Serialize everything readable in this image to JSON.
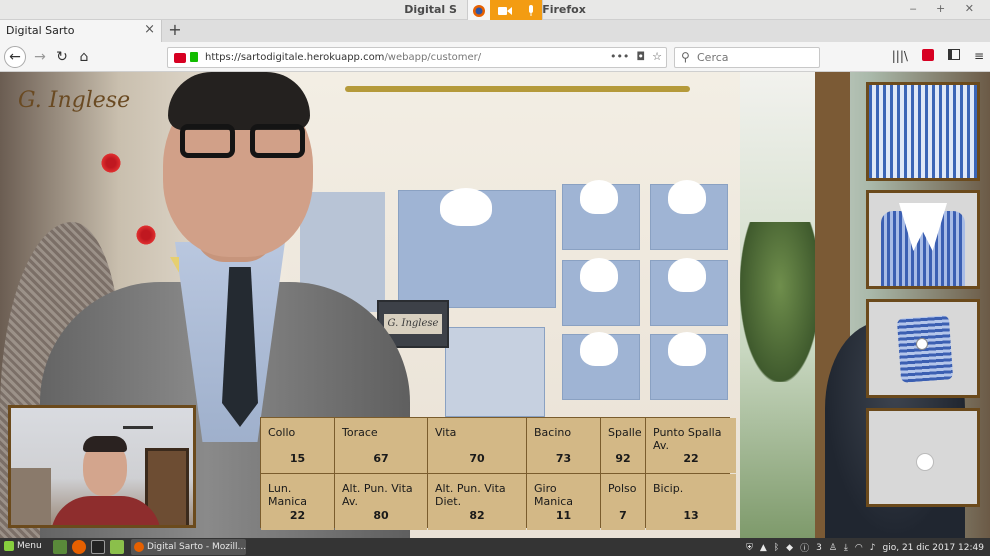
{
  "window": {
    "title": "Digital Sarto - Mozilla Firefox",
    "title_left": "Digital S",
    "title_right": "a Firefox",
    "controls": "‒ + ✕"
  },
  "tab": {
    "title": "Digital Sarto",
    "close": "×",
    "new_tab": "+"
  },
  "nav": {
    "back": "←",
    "forward": "→",
    "reload": "↻",
    "home": "⌂",
    "url_host": "https://sartodigitale.herokuapp.com",
    "url_path": "/webapp/customer/",
    "more": "•••",
    "pocket": "◘",
    "bookmark": "☆"
  },
  "search": {
    "placeholder": "Cerca",
    "icon": "search-icon"
  },
  "toolbar": {
    "library": "|||\\",
    "menu": "≡"
  },
  "page": {
    "logo": "G. Inglese",
    "sign_text": "G. Inglese"
  },
  "measurements": [
    {
      "label": "Collo",
      "value": "15"
    },
    {
      "label": "Torace",
      "value": "67"
    },
    {
      "label": "Vita",
      "value": "70"
    },
    {
      "label": "Bacino",
      "value": "73"
    },
    {
      "label": "Spalle",
      "value": "92"
    },
    {
      "label": "Punto Spalla Av.",
      "value": "22"
    },
    {
      "label": "Lun. Manica",
      "value": "22"
    },
    {
      "label": "Alt. Pun. Vita Av.",
      "value": "80"
    },
    {
      "label": "Alt. Pun. Vita Diet.",
      "value": "82"
    },
    {
      "label": "Giro Manica",
      "value": "11"
    },
    {
      "label": "Polso",
      "value": "7"
    },
    {
      "label": "Bicip.",
      "value": "13"
    }
  ],
  "taskbar": {
    "menu_label": "Menu",
    "window_label": "Digital Sarto - Mozill...",
    "tray_count": "3",
    "clock": "gio, 21 dic 2017 12:49"
  },
  "colors": {
    "frame": "#6b4a1c",
    "cell": "#d3b886",
    "recording": "#d70022",
    "secure": "#12bc00"
  }
}
